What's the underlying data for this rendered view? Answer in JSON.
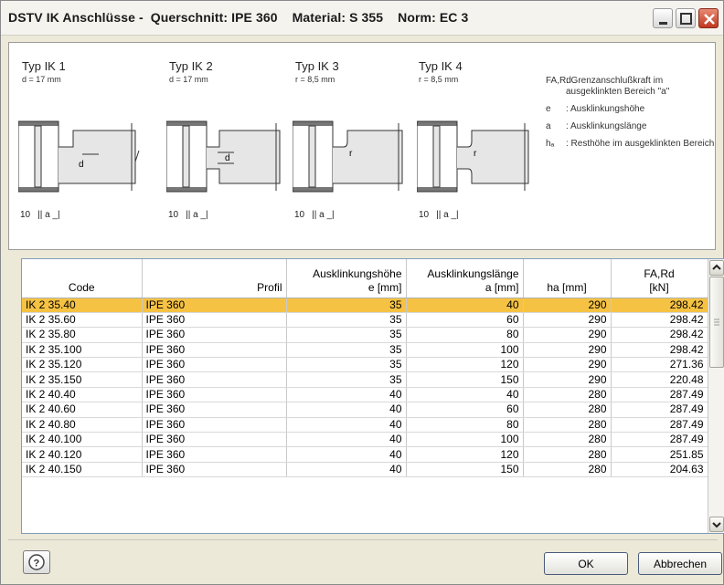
{
  "window": {
    "title": "DSTV IK Anschlüsse -  Querschnitt: IPE 360    Material: S 355    Norm: EC 3",
    "controls": {
      "minimize": "minimize-icon",
      "maximize": "maximize-icon",
      "close": "close-icon"
    }
  },
  "legend": {
    "types": [
      {
        "name": "Typ IK 1",
        "param": "d = 17 mm"
      },
      {
        "name": "Typ IK 2",
        "param": "d = 17 mm"
      },
      {
        "name": "Typ IK 3",
        "param": "r = 8,5 mm"
      },
      {
        "name": "Typ IK 4",
        "param": "r = 8,5 mm"
      }
    ],
    "dim_10": "10",
    "dim_a": "a",
    "definitions": [
      {
        "symbol": "FA,Rd",
        "text": ": Grenzanschlußkraft im ausgeklinkten Bereich \"a\""
      },
      {
        "symbol": "e",
        "text": ": Ausklinkungshöhe"
      },
      {
        "symbol": "a",
        "text": ": Ausklinkungslänge"
      },
      {
        "symbol": "hₐ",
        "text": ": Resthöhe im ausgeklinkten Bereich"
      }
    ]
  },
  "table": {
    "headers": {
      "code": "Code",
      "profil": "Profil",
      "e_l1": "Ausklinkungshöhe",
      "e_l2": "e [mm]",
      "a_l1": "Ausklinkungslänge",
      "a_l2": "a [mm]",
      "ha": "ha [mm]",
      "far_l1": "FA,Rd",
      "far_l2": "[kN]"
    },
    "selected_row": 0,
    "rows": [
      {
        "code": "IK 2 35.40",
        "profil": "IPE 360",
        "e": "35",
        "a": "40",
        "ha": "290",
        "far": "298.42"
      },
      {
        "code": "IK 2 35.60",
        "profil": "IPE 360",
        "e": "35",
        "a": "60",
        "ha": "290",
        "far": "298.42"
      },
      {
        "code": "IK 2 35.80",
        "profil": "IPE 360",
        "e": "35",
        "a": "80",
        "ha": "290",
        "far": "298.42"
      },
      {
        "code": "IK 2 35.100",
        "profil": "IPE 360",
        "e": "35",
        "a": "100",
        "ha": "290",
        "far": "298.42"
      },
      {
        "code": "IK 2 35.120",
        "profil": "IPE 360",
        "e": "35",
        "a": "120",
        "ha": "290",
        "far": "271.36"
      },
      {
        "code": "IK 2 35.150",
        "profil": "IPE 360",
        "e": "35",
        "a": "150",
        "ha": "290",
        "far": "220.48"
      },
      {
        "code": "IK 2 40.40",
        "profil": "IPE 360",
        "e": "40",
        "a": "40",
        "ha": "280",
        "far": "287.49"
      },
      {
        "code": "IK 2 40.60",
        "profil": "IPE 360",
        "e": "40",
        "a": "60",
        "ha": "280",
        "far": "287.49"
      },
      {
        "code": "IK 2 40.80",
        "profil": "IPE 360",
        "e": "40",
        "a": "80",
        "ha": "280",
        "far": "287.49"
      },
      {
        "code": "IK 2 40.100",
        "profil": "IPE 360",
        "e": "40",
        "a": "100",
        "ha": "280",
        "far": "287.49"
      },
      {
        "code": "IK 2 40.120",
        "profil": "IPE 360",
        "e": "40",
        "a": "120",
        "ha": "280",
        "far": "251.85"
      },
      {
        "code": "IK 2 40.150",
        "profil": "IPE 360",
        "e": "40",
        "a": "150",
        "ha": "280",
        "far": "204.63"
      }
    ]
  },
  "buttons": {
    "help_icon": "help-icon",
    "ok": "OK",
    "cancel": "Abbrechen"
  },
  "colors": {
    "selection": "#f5c243",
    "accent": "#7f9db9"
  }
}
